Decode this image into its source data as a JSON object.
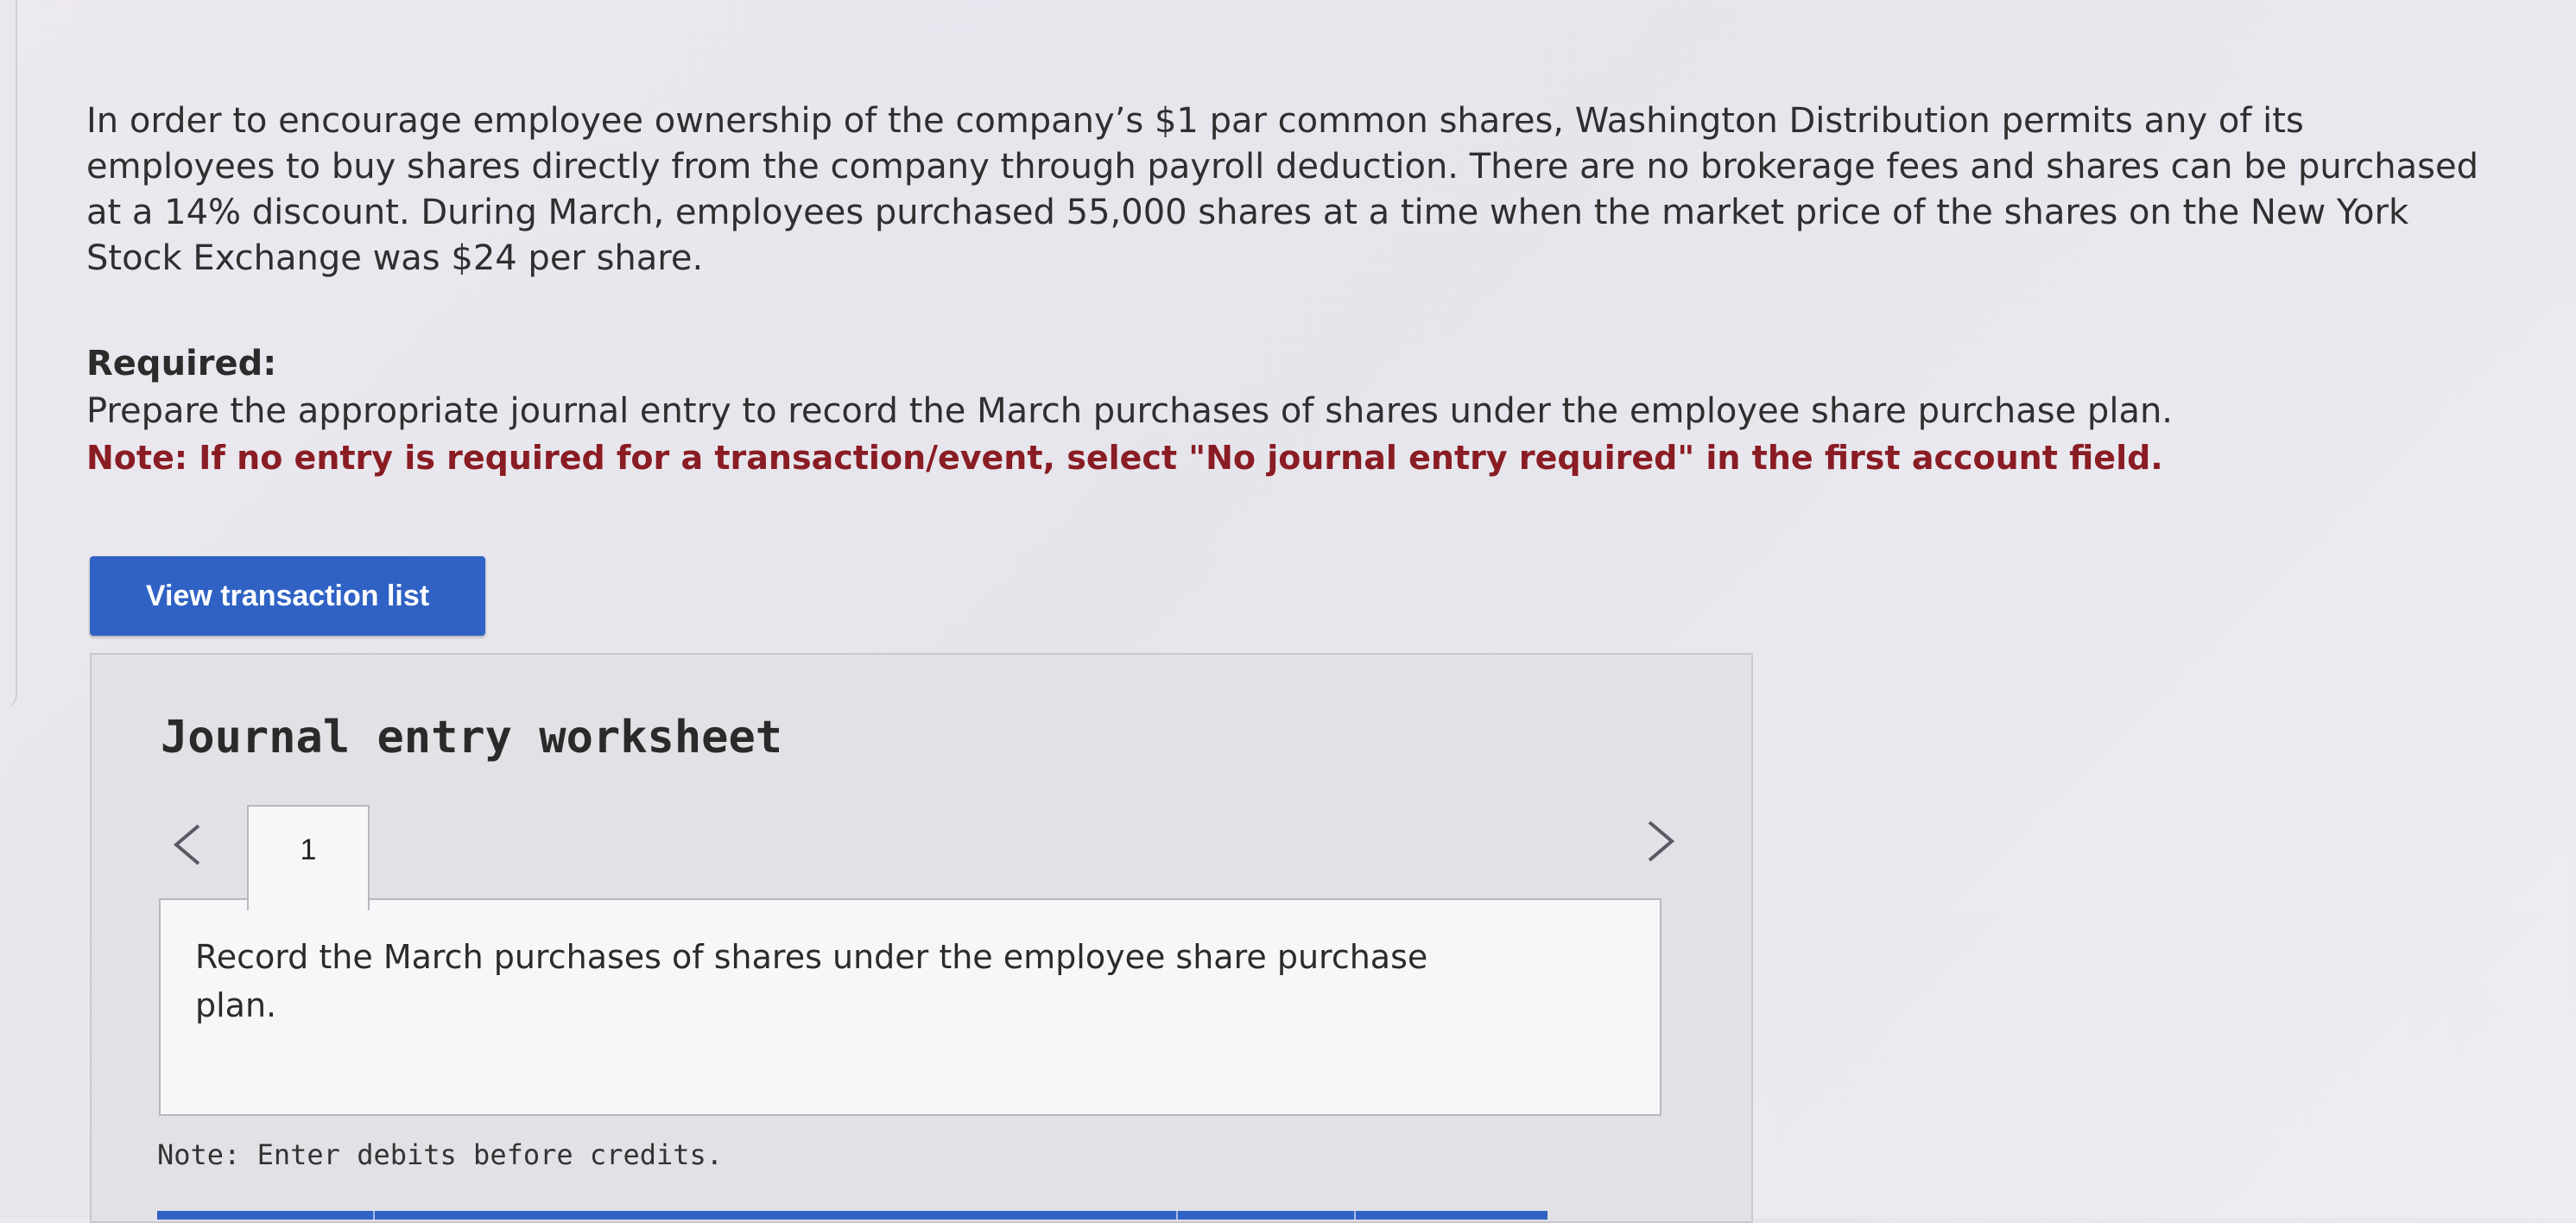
{
  "problem": {
    "text": "In order to encourage employee ownership of the company’s $1 par common shares, Washington Distribution permits any of its employees to buy shares directly from the company through payroll deduction. There are no brokerage fees and shares can be purchased at a 14% discount. During March, employees purchased 55,000 shares at a time when the market price of the shares on the New York Stock Exchange was $24 per share."
  },
  "required": {
    "label": "Required:",
    "text": "Prepare the appropriate journal entry to record the March purchases of shares under the employee share purchase plan.",
    "note": "Note: If no entry is required for a transaction/event, select \"No journal entry required\" in the first account field."
  },
  "view_button": {
    "label": "View transaction list"
  },
  "worksheet": {
    "title": "Journal entry worksheet",
    "tabs": [
      {
        "label": "1"
      }
    ],
    "instruction": "Record the March purchases of shares under the employee share purchase plan.",
    "note": "Note: Enter debits before credits."
  },
  "colors": {
    "accent": "#2f62c4",
    "note_red": "#8a1c24"
  },
  "icons": {
    "prev": "chevron-left-icon",
    "next": "chevron-right-icon"
  }
}
